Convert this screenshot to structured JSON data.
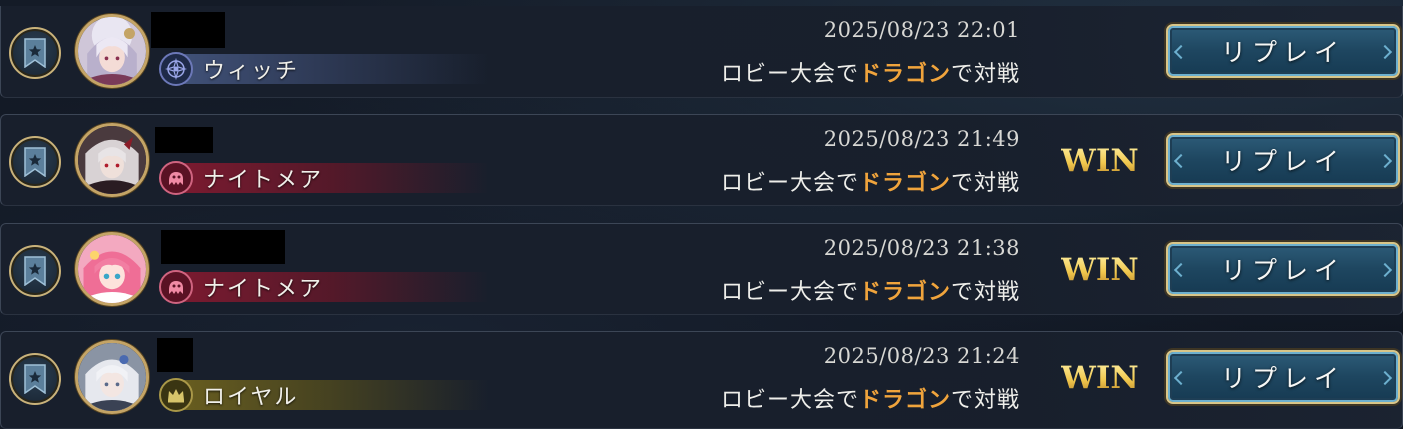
{
  "accent": {
    "opponent_class_color": "#f0a43c",
    "win_color": "#f1c84e",
    "frame_gold": "#d8c588"
  },
  "battles": [
    {
      "player_class": "ウィッチ",
      "class_icon": "witch-emblem-icon",
      "date": "2025/08/23 22:01",
      "match_prefix": "ロビー大会で",
      "opponent_class": "ドラゴン",
      "match_suffix": "で対戦",
      "result": "",
      "replay_label": "リプレイ"
    },
    {
      "player_class": "ナイトメア",
      "class_icon": "nightmare-emblem-icon",
      "date": "2025/08/23 21:49",
      "match_prefix": "ロビー大会で",
      "opponent_class": "ドラゴン",
      "match_suffix": "で対戦",
      "result": "WIN",
      "replay_label": "リプレイ"
    },
    {
      "player_class": "ナイトメア",
      "class_icon": "nightmare-emblem-icon",
      "date": "2025/08/23 21:38",
      "match_prefix": "ロビー大会で",
      "opponent_class": "ドラゴン",
      "match_suffix": "で対戦",
      "result": "WIN",
      "replay_label": "リプレイ"
    },
    {
      "player_class": "ロイヤル",
      "class_icon": "royal-crown-icon",
      "date": "2025/08/23 21:24",
      "match_prefix": "ロビー大会で",
      "opponent_class": "ドラゴン",
      "match_suffix": "で対戦",
      "result": "WIN",
      "replay_label": "リプレイ"
    }
  ]
}
